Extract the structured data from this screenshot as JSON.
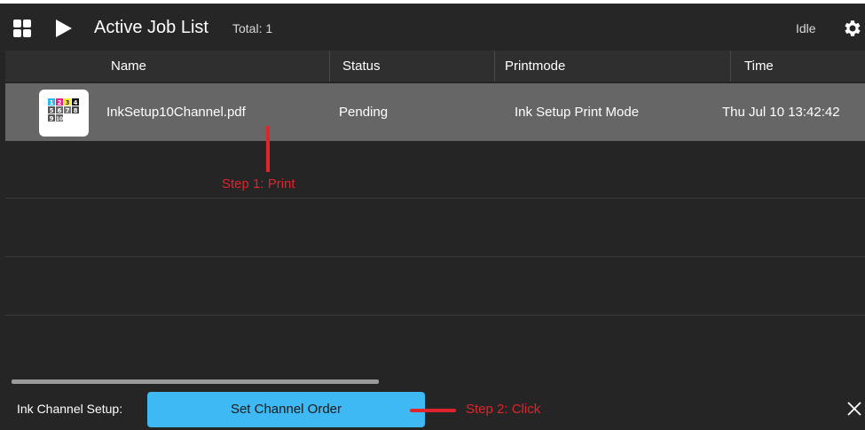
{
  "topbar": {
    "title": "Active Job List",
    "total": "Total: 1",
    "status": "Idle"
  },
  "columns": [
    "Name",
    "Status",
    "Printmode",
    "Time"
  ],
  "jobs": [
    {
      "name": "InkSetup10Channel.pdf",
      "status": "Pending",
      "printmode": "Ink Setup Print Mode",
      "time": "Thu Jul 10 13:42:42",
      "thumbnail_digits": [
        "1",
        "2",
        "3",
        "4",
        "5",
        "6",
        "7",
        "8",
        "9",
        "10"
      ]
    }
  ],
  "bottom": {
    "label": "Ink Channel Setup:",
    "button": "Set Channel Order"
  },
  "annotations": {
    "step1": "Step 1: Print",
    "step2": "Step 2: Click",
    "color": "#e0242b"
  },
  "colors": {
    "accent": "#3fb9f4",
    "background": "#252525",
    "selected_row": "#666666"
  },
  "icons": [
    "grid-icon",
    "play-icon",
    "gear-icon",
    "close-icon"
  ]
}
